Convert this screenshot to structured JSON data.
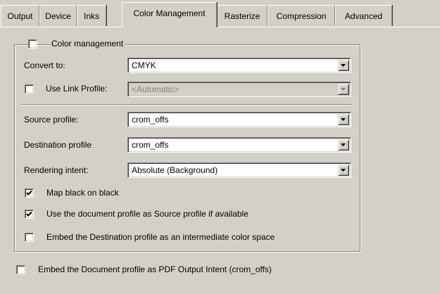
{
  "tabs": {
    "output": "Output",
    "device": "Device",
    "inks": "Inks",
    "color_management": "Color Management",
    "rasterize": "Rasterize",
    "compression": "Compression",
    "advanced": "Advanced"
  },
  "color_management": {
    "group_label": "Color management",
    "enabled": false,
    "convert_to_label": "Convert to:",
    "convert_to_value": "CMYK",
    "use_link_profile_label": "Use Link Profile:",
    "use_link_profile_checked": false,
    "link_profile_value": "<Automatic>",
    "source_profile_label": "Source profile:",
    "source_profile_value": "crom_offs",
    "destination_profile_label": "Destination profile",
    "destination_profile_value": "crom_offs",
    "rendering_intent_label": "Rendering intent:",
    "rendering_intent_value": "Absolute (Background)",
    "map_black_label": "Map black on black",
    "map_black_checked": true,
    "use_doc_profile_label": "Use the document profile as Source profile if available",
    "use_doc_profile_checked": true,
    "embed_dest_label": "Embed the Destination profile as an intermediate color space",
    "embed_dest_checked": false
  },
  "embed_doc_profile_label": "Embed the Document profile as PDF Output Intent (crom_offs)",
  "embed_doc_profile_checked": false,
  "icons": {
    "dropdown": "chevron-down-icon",
    "check": "checkmark-icon"
  }
}
